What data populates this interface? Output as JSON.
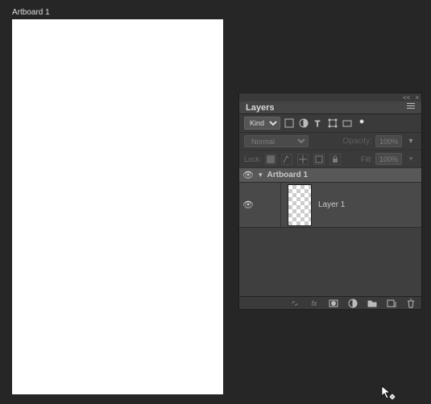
{
  "artboard": {
    "label": "Artboard 1"
  },
  "panel": {
    "title": "Layers",
    "filter_kind": "Kind",
    "blend_mode": "Normal",
    "opacity_label": "Opacity:",
    "opacity_value": "100%",
    "lock_label": "Lock:",
    "fill_label": "Fill:",
    "fill_value": "100%"
  },
  "layers": {
    "artboard_name": "Artboard 1",
    "items": [
      {
        "name": "Layer 1"
      }
    ]
  },
  "icons": {
    "collapse": "<<",
    "close": "×"
  }
}
